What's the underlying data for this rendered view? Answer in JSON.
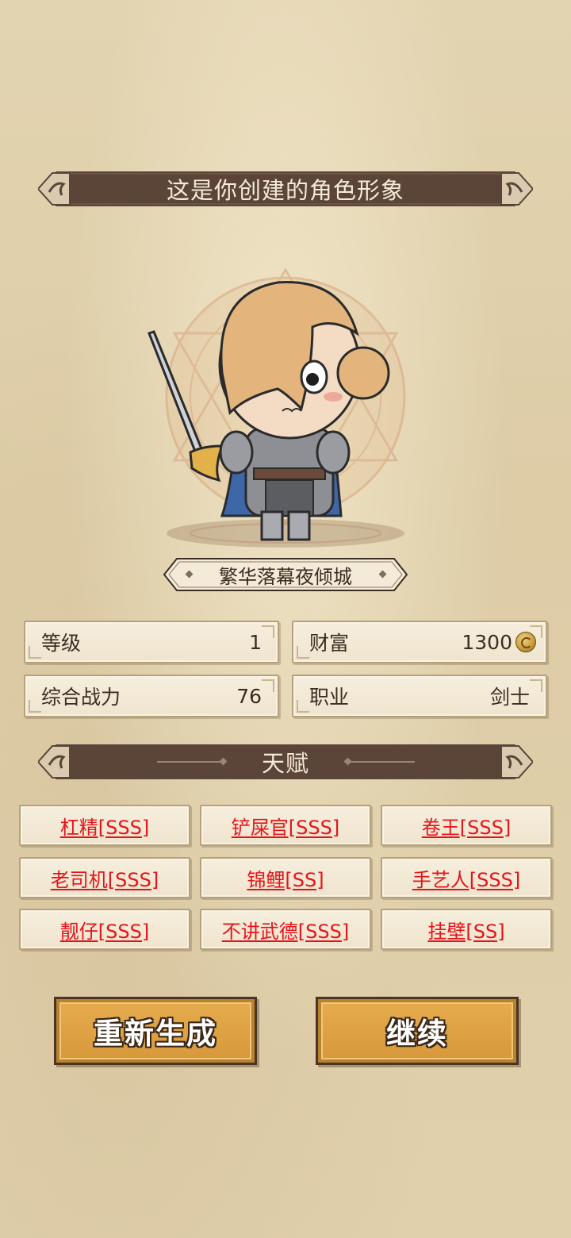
{
  "header": {
    "title": "这是你创建的角色形象"
  },
  "character": {
    "name": "繁华落幕夜倾城",
    "class_icon": "swordsman-character-portrait"
  },
  "stats": {
    "level_label": "等级",
    "level_value": "1",
    "wealth_label": "财富",
    "wealth_value": "1300",
    "power_label": "综合战力",
    "power_value": "76",
    "job_label": "职业",
    "job_value": "剑士"
  },
  "talents_section": {
    "title": "天赋",
    "items": [
      "杠精[SSS]",
      "铲屎官[SSS]",
      "卷王[SSS]",
      "老司机[SSS]",
      "锦鲤[SS]",
      "手艺人[SSS]",
      "靓仔[SSS]",
      "不讲武德[SSS]",
      "挂壁[SS]"
    ]
  },
  "buttons": {
    "regenerate": "重新生成",
    "continue": "继续"
  },
  "colors": {
    "banner": "#5b4538",
    "talent_text": "#e5141b",
    "button_fill": "#d99b3d",
    "parchment": "#e0d0ac"
  }
}
